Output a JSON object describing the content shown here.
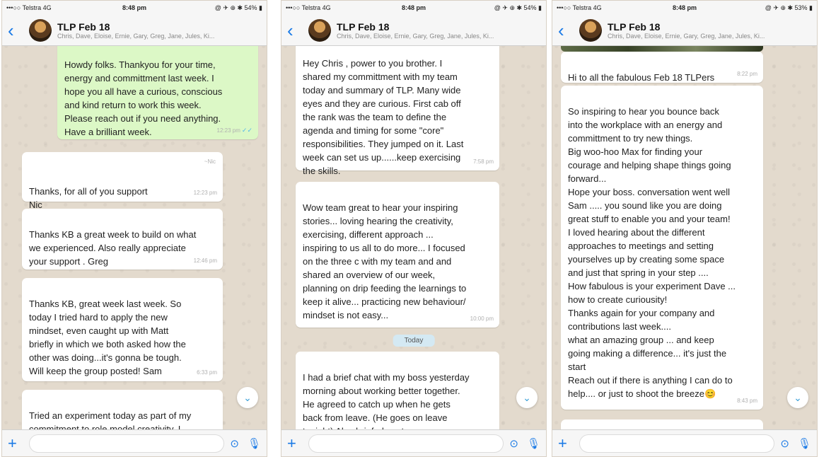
{
  "screens": [
    {
      "status": {
        "carrier": "•••○○ Telstra  4G",
        "time": "8:48 pm",
        "right": "@ ✈ ⊕ ✱ 54% ▮"
      },
      "header": {
        "title": "TLP Feb 18",
        "subtitle": "Chris, Dave, Eloise, Ernie, Gary, Greg, Jane, Jules, Ki..."
      },
      "messages": [
        {
          "text": "Howdy folks. Thankyou for your time,\nenergy and committment last week. I\nhope you all have a curious, conscious\nand kind return to work this week.\nPlease reach out if you need anything.\nHave a brilliant week.",
          "time": "12:23 pm"
        },
        {
          "sender": "~Nic",
          "text": "Thanks, for all of you support\nNic",
          "time": "12:23 pm"
        },
        {
          "text": "Thanks KB a great week to build on what\nwe experienced.  Also really appreciate\nyour support . Greg",
          "time": "12:46 pm"
        },
        {
          "text": "Thanks KB, great week last week. So\ntoday I tried hard to apply the new\nmindset, even caught up with Matt\nbriefly in which we both asked how the\nother was doing...it's gonna be tough.\nWill keep the group posted! Sam",
          "time": "6:33 pm"
        },
        {
          "text": "Tried an experiment today as part of my\ncommitment  to role model creativity.  I",
          "time": ""
        }
      ],
      "composer": {
        "placeholder": ""
      }
    },
    {
      "status": {
        "carrier": "•••○○ Telstra  4G",
        "time": "8:48 pm",
        "right": "@ ✈ ⊕ ✱ 54% ▮"
      },
      "header": {
        "title": "TLP Feb 18",
        "subtitle": "Chris, Dave, Eloise, Ernie, Gary, Greg, Jane, Jules, Ki..."
      },
      "messages": [
        {
          "text": "Hey Chris , power to you brother. I\nshared my committment with my team\ntoday and summary of TLP. Many wide\neyes and they are curious. First cab off\nthe rank was the team to define the\nagenda and timing for some \"core\"\nresponsibilities.   They jumped on it. Last\nweek can set us up......keep exercising\nthe skills.",
          "time": "7:58 pm"
        },
        {
          "text": "Wow team great to hear your inspiring\nstories... loving hearing the creativity,\nexercising, different approach ...\ninspiring to us all to do more... I focused\non the three c with my team and and\nshared an overview of our week,\nplanning on drip feeding the learnings to\nkeep it alive... practicing new behaviour/\nmindset is not easy...",
          "time": "10:00 pm"
        },
        {
          "text": "I had a brief chat with my boss yesterday\nmorning about working better together.\nHe agreed to catch up when he gets\nback from leave. (He goes on leave\ntonight)  Also briefed my team on my",
          "time": ""
        }
      ],
      "day_label": "Today",
      "composer": {
        "placeholder": ""
      }
    },
    {
      "status": {
        "carrier": "•••○○ Telstra  4G",
        "time": "8:48 pm",
        "right": "@ ✈ ⊕ ✱ 53% ▮"
      },
      "header": {
        "title": "TLP Feb 18",
        "subtitle": "Chris, Dave, Eloise, Ernie, Gary, Greg, Jane, Jules, Ki..."
      },
      "messages": [
        {
          "text": "Hi to all the fabulous Feb 18 TLPers",
          "time": "8:22 pm"
        },
        {
          "text": "So inspiring to hear you bounce back\ninto the workplace with an energy and\ncommittment to try new things.\nBig woo-hoo Max for finding your\ncourage and helping shape things going\nforward...\nHope your boss. conversation went well\nSam ..... you sound like you are doing\ngreat stuff to enable you and your team!\nI loved hearing about the different\napproaches to meetings and setting\nyourselves up by creating some space\nand just that spring in your step  ....\nHow fabulous is your experiment Dave ...\nhow to create curiousity!\nThanks again for your company and\ncontributions last week....\nwhat an amazing group ... and keep\ngoing making a difference... it's just the\nstart\nReach out if there is anything I can do to\nhelp.... or just to shoot the breeze😊",
          "time": "8:43 pm"
        }
      ],
      "composer": {
        "placeholder": ""
      }
    }
  ],
  "icons": {
    "back": "‹",
    "plus": "+",
    "camera": "⊙",
    "mic": "🎙",
    "scroll_down": "⌄"
  }
}
